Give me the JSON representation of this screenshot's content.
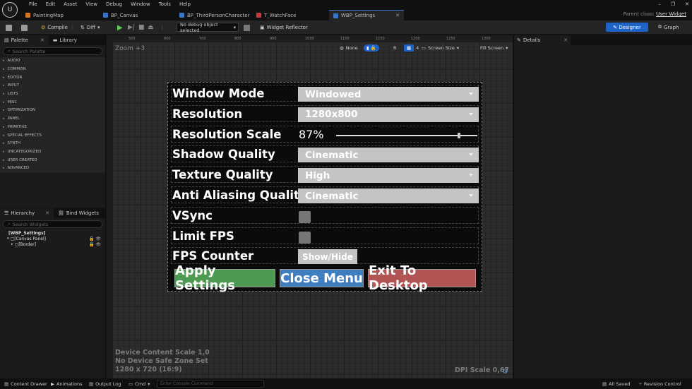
{
  "menubar": {
    "logo": "U",
    "items": [
      "File",
      "Edit",
      "Asset",
      "View",
      "Debug",
      "Window",
      "Tools",
      "Help"
    ]
  },
  "tabs": [
    {
      "label": "PaintingMap",
      "color": "#d07a2a"
    },
    {
      "label": "BP_Canvas",
      "color": "#3a76c8"
    },
    {
      "label": "BP_ThirdPersonCharacter",
      "color": "#3a76c8"
    },
    {
      "label": "T_WatchFace",
      "color": "#c83a3a"
    },
    {
      "label": "WBP_Settings",
      "color": "#3a76c8"
    }
  ],
  "parent_class": {
    "label": "Parent class:",
    "value": "User Widget"
  },
  "toolbar": {
    "compile": "Compile",
    "diff": "Diff",
    "debug_object": "No debug object selected",
    "widget_reflector": "Widget Reflector",
    "designer": "Designer",
    "graph": "Graph"
  },
  "palette": {
    "tab1": "Palette",
    "tab2": "Library",
    "search_placeholder": "Search Palette",
    "categories": [
      "AUDIO",
      "COMMON",
      "EDITOR",
      "INPUT",
      "LISTS",
      "MISC",
      "OPTIMIZATION",
      "PANEL",
      "PRIMITIVE",
      "SPECIAL EFFECTS",
      "SYNTH",
      "UNCATEGORIZED",
      "USER CREATED",
      "ADVANCED"
    ]
  },
  "hierarchy": {
    "tab1": "Hierarchy",
    "tab2": "Bind Widgets",
    "search_placeholder": "Search Widgets",
    "items": [
      "[WBP_Settings]",
      "[Canvas Panel]",
      "[Border]"
    ]
  },
  "viewport": {
    "zoom": "Zoom +3",
    "ruler_labels": [
      "500",
      "600",
      "700",
      "800",
      "900",
      "1000",
      "1100",
      "1150",
      "1200",
      "1250",
      "1300"
    ],
    "none_label": "None",
    "r_label": "R",
    "grid_num": "4",
    "screen_size": "Screen Size",
    "fill_screen": "Fill Screen",
    "device_info": [
      "Device Content Scale 1,0",
      "No Device Safe Zone Set",
      "1280 x 720 (16:9)"
    ],
    "dpi_scale": "DPI Scale 0,67"
  },
  "settings": {
    "rows": [
      {
        "label": "Window Mode",
        "type": "combo",
        "value": "Windowed"
      },
      {
        "label": "Resolution",
        "type": "combo",
        "value": "1280x800"
      },
      {
        "label": "Resolution Scale",
        "type": "slider",
        "value": "87%"
      },
      {
        "label": "Shadow Quality",
        "type": "combo",
        "value": "Cinematic"
      },
      {
        "label": "Texture Quality",
        "type": "combo",
        "value": "High"
      },
      {
        "label": "Anti Aliasing Quality",
        "type": "combo",
        "value": "Cinematic"
      },
      {
        "label": "VSync",
        "type": "check"
      },
      {
        "label": "Limit FPS",
        "type": "check"
      },
      {
        "label": "FPS Counter",
        "type": "button",
        "value": "Show/Hide"
      }
    ],
    "slider_fraction": 0.87,
    "buttons": [
      {
        "label": "Apply Settings",
        "color": "#4f9a52"
      },
      {
        "label": "Close Menu",
        "color": "#3f7fc0"
      },
      {
        "label": "Exit To Desktop",
        "color": "#b05454"
      }
    ]
  },
  "details": {
    "tab": "Details"
  },
  "statusbar": {
    "content_drawer": "Content Drawer",
    "animations": "Animations",
    "output_log": "Output Log",
    "cmd": "Cmd",
    "console_placeholder": "Enter Console Command",
    "all_saved": "All Saved",
    "revision": "Revision Control"
  }
}
